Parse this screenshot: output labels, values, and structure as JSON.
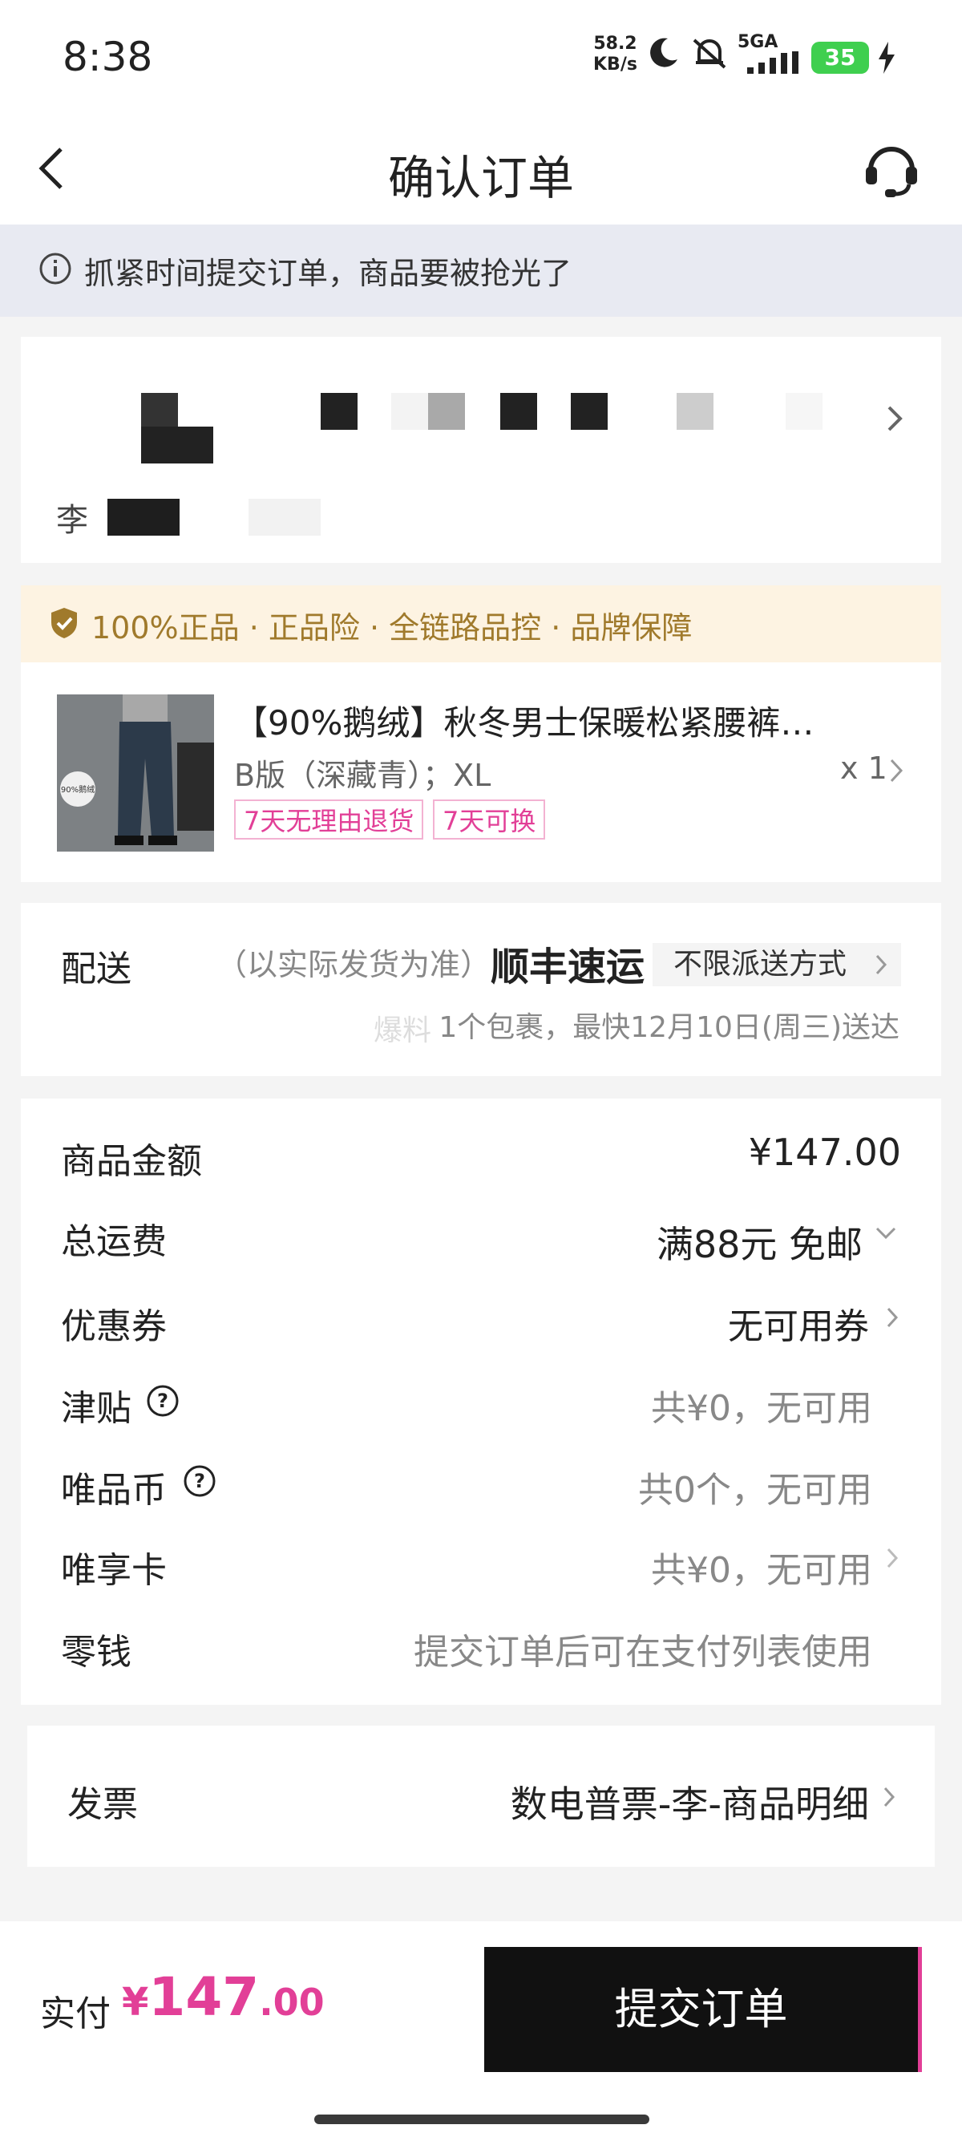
{
  "status_bar": {
    "time": "8:38",
    "net_speed_value": "58.2",
    "net_speed_unit": "KB/s",
    "network": "5GA",
    "battery": "35"
  },
  "header": {
    "title": "确认订单"
  },
  "notice": {
    "text": "抓紧时间提交订单，商品要被抢光了"
  },
  "address": {
    "prefix": "李"
  },
  "guarantee": {
    "text": "100%正品 · 正品险 · 全链路品控 · 品牌保障"
  },
  "product": {
    "title": "【90%鹅绒】秋冬男士保暖松紧腰裤…",
    "spec": "B版（深藏青）；XL",
    "qty": "x 1",
    "img_badge": "90%鹅绒",
    "tags": [
      "7天无理由退货",
      "7天可换"
    ]
  },
  "shipping": {
    "label": "配送",
    "note": "（以实际发货为准）",
    "carrier": "顺丰速运",
    "method": "不限派送方式",
    "eta_prefix": "爆料",
    "eta": "1个包裹，最快12月10日(周三)送达"
  },
  "costs": {
    "goods_label": "商品金额",
    "goods_value": "¥147.00",
    "freight_label": "总运费",
    "freight_value": "满88元 免邮",
    "coupon_label": "优惠券",
    "coupon_value": "无可用券",
    "subsidy_label": "津贴",
    "subsidy_value": "共¥0，无可用",
    "coin_label": "唯品币",
    "coin_value": "共0个，无可用",
    "card_label": "唯享卡",
    "card_value": "共¥0，无可用",
    "change_label": "零钱",
    "change_value": "提交订单后可在支付列表使用"
  },
  "invoice": {
    "label": "发票",
    "value": "数电普票-李-商品明细"
  },
  "footer": {
    "pay_label": "实付",
    "price_symbol": "¥",
    "price_int": "147",
    "price_dec": ".00",
    "submit_label": "提交订单"
  },
  "colors": {
    "accent": "#e23f97",
    "guarantee_text": "#a07a2c",
    "submit_bg": "#111111"
  }
}
